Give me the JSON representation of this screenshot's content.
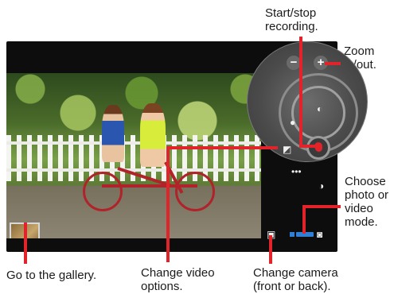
{
  "callouts": {
    "start_stop": "Start/stop\nrecording.",
    "zoom": "Zoom\nin/out.",
    "choose_mode": "Choose\nphoto or\nvideo\nmode.",
    "gallery": "Go to the gallery.",
    "video_options": "Change video\noptions.",
    "change_camera": "Change camera\n(front or back)."
  },
  "controls": {
    "zoom_out": "−",
    "zoom_in": "+",
    "more": "•••"
  },
  "colors": {
    "accent_red": "#e3232a",
    "mode_blue": "#2f7fd6"
  },
  "icons": {
    "zoom_out": "minus-icon",
    "zoom_in": "plus-icon",
    "flash": "flash-icon",
    "effects": "effects-icon",
    "settings": "settings-icon",
    "video_mode": "video-camera-icon",
    "photo_mode": "camera-icon",
    "switch_camera": "switch-camera-icon"
  }
}
